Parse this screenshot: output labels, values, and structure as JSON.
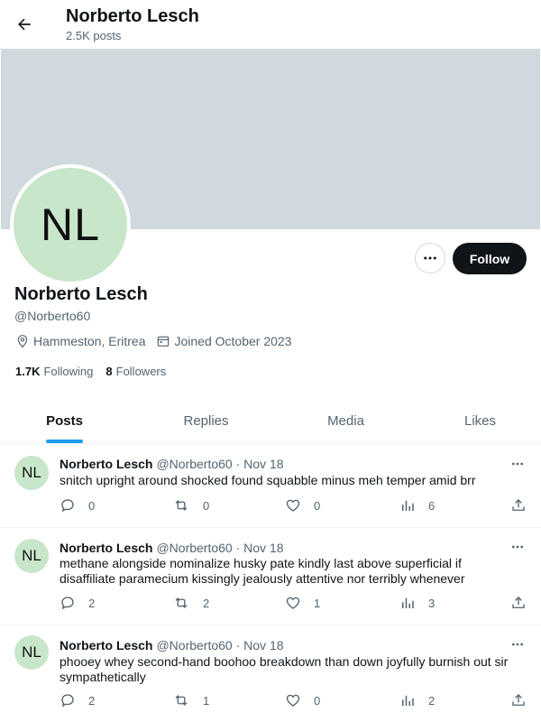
{
  "header": {
    "name": "Norberto Lesch",
    "posts_count": "2.5K posts"
  },
  "profile": {
    "avatar_initials": "NL",
    "display_name": "Norberto Lesch",
    "handle": "@Norberto60",
    "location": "Hammeston, Eritrea",
    "joined": "Joined October 2023",
    "following_count": "1.7K",
    "following_label": "Following",
    "followers_count": "8",
    "followers_label": "Followers",
    "follow_label": "Follow"
  },
  "tabs": [
    {
      "label": "Posts",
      "active": true
    },
    {
      "label": "Replies",
      "active": false
    },
    {
      "label": "Media",
      "active": false
    },
    {
      "label": "Likes",
      "active": false
    }
  ],
  "posts": [
    {
      "avatar": "NL",
      "author": "Norberto Lesch",
      "meta": "@Norberto60 · Nov 18",
      "text": "snitch upright around shocked found squabble minus meh temper amid brr",
      "replies": "0",
      "reposts": "0",
      "likes": "0",
      "views": "6"
    },
    {
      "avatar": "NL",
      "author": "Norberto Lesch",
      "meta": "@Norberto60 · Nov 18",
      "text": "methane alongside nominalize husky pate kindly last above superficial if disaffiliate paramecium kissingly jealously attentive nor terribly whenever",
      "replies": "2",
      "reposts": "2",
      "likes": "1",
      "views": "3"
    },
    {
      "avatar": "NL",
      "author": "Norberto Lesch",
      "meta": "@Norberto60 · Nov 18",
      "text": "phooey whey second-hand boohoo breakdown than down joyfully burnish out sir sympathetically",
      "replies": "2",
      "reposts": "1",
      "likes": "0",
      "views": "2"
    }
  ],
  "colors": {
    "accent": "#1d9bf0",
    "banner": "#cfd9de",
    "avatar_bg": "#c8e6c9",
    "text": "#0f1419",
    "muted": "#536471"
  }
}
